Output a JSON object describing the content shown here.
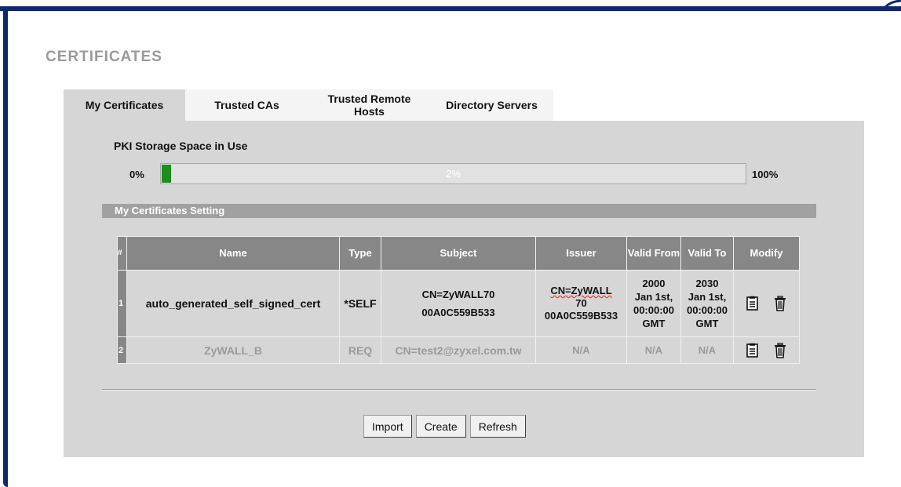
{
  "page": {
    "title": "CERTIFICATES"
  },
  "tabs": [
    {
      "label": "My Certificates",
      "active": true
    },
    {
      "label": "Trusted CAs",
      "active": false
    },
    {
      "label": "Trusted Remote Hosts",
      "active": false
    },
    {
      "label": "Directory Servers",
      "active": false
    }
  ],
  "storage": {
    "label": "PKI Storage Space in Use",
    "min_label": "0%",
    "max_label": "100%",
    "value_label": "2%",
    "value": 0.02,
    "fill_color": "#1b8f1b"
  },
  "section": {
    "title": "My Certificates Setting"
  },
  "table": {
    "headers": {
      "index": "#",
      "name": "Name",
      "type": "Type",
      "subject": "Subject",
      "issuer": "Issuer",
      "valid_from": "Valid From",
      "valid_to": "Valid To",
      "modify": "Modify"
    },
    "rows": [
      {
        "index": "1",
        "name": "auto_generated_self_signed_cert",
        "type": "*SELF",
        "subject_line1": "CN=ZyWALL70",
        "subject_line2": "00A0C559B533",
        "issuer_line1": "CN=ZyWALL",
        "issuer_line2": "70",
        "issuer_line3": "00A0C559B533",
        "valid_from_line1": "2000",
        "valid_from_line2": "Jan 1st,",
        "valid_from_line3": "00:00:00",
        "valid_from_line4": "GMT",
        "valid_to_line1": "2030",
        "valid_to_line2": "Jan 1st,",
        "valid_to_line3": "00:00:00",
        "valid_to_line4": "GMT",
        "icons": [
          "edit-icon",
          "delete-icon"
        ]
      },
      {
        "index": "2",
        "name": "ZyWALL_B",
        "type": "REQ",
        "subject": "CN=test2@zyxel.com.tw",
        "issuer": "N/A",
        "valid_from": "N/A",
        "valid_to": "N/A",
        "icons": [
          "edit-icon",
          "delete-icon"
        ]
      }
    ]
  },
  "buttons": {
    "import": "Import",
    "create": "Create",
    "refresh": "Refresh"
  },
  "colors": {
    "frame": "#0d2a6e",
    "header": "#878787",
    "panel": "#d6d6d6",
    "section": "#a1a1a1"
  }
}
